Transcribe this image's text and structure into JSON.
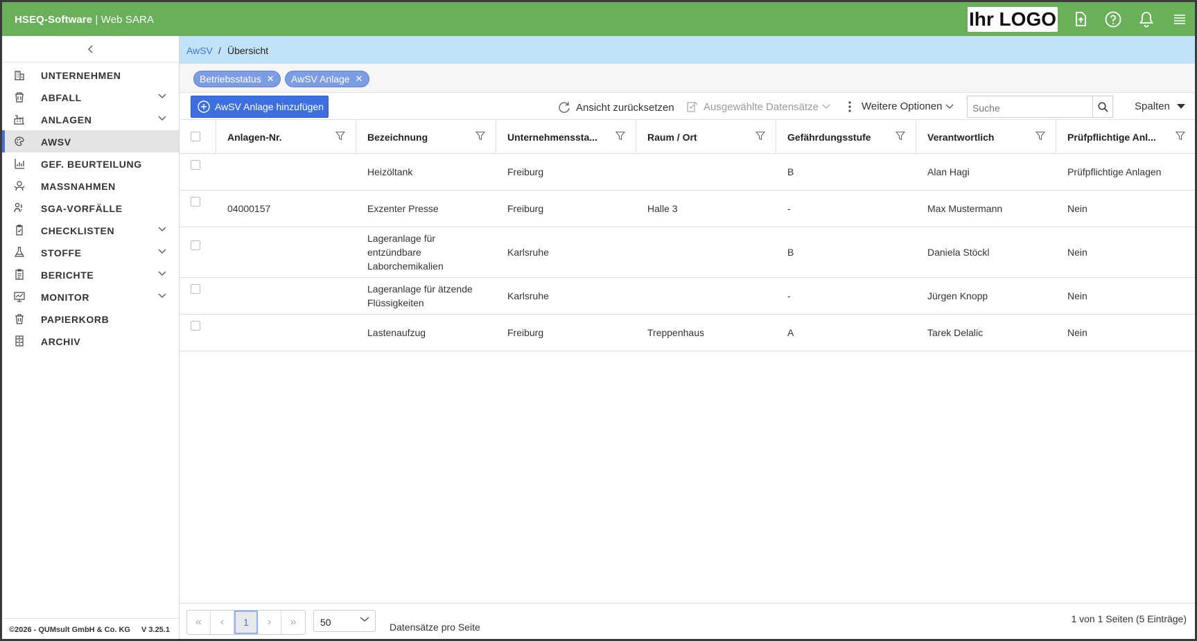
{
  "header": {
    "brand_bold": "HSEQ-Software",
    "brand_sep": " | ",
    "brand_rest": "Web SARA",
    "logo_text": "Ihr LOGO",
    "icons": [
      "file-upload-icon",
      "help-icon",
      "bell-icon",
      "menu-icon"
    ]
  },
  "sidebar": {
    "items": [
      {
        "label": "UNTERNEHMEN",
        "icon": "building-icon",
        "chevron": false,
        "active": false
      },
      {
        "label": "ABFALL",
        "icon": "waste-bin-icon",
        "chevron": true,
        "active": false
      },
      {
        "label": "ANLAGEN",
        "icon": "factory-icon",
        "chevron": true,
        "active": false
      },
      {
        "label": "AWSV",
        "icon": "water-drop-icon",
        "chevron": false,
        "active": true
      },
      {
        "label": "GEF. BEURTEILUNG",
        "icon": "risk-chart-icon",
        "chevron": false,
        "active": false
      },
      {
        "label": "MASSNAHMEN",
        "icon": "measures-icon",
        "chevron": false,
        "active": false
      },
      {
        "label": "SGA-VORFÄLLE",
        "icon": "incident-icon",
        "chevron": false,
        "active": false
      },
      {
        "label": "CHECKLISTEN",
        "icon": "clipboard-check-icon",
        "chevron": true,
        "active": false
      },
      {
        "label": "STOFFE",
        "icon": "flask-icon",
        "chevron": true,
        "active": false
      },
      {
        "label": "BERICHTE",
        "icon": "report-icon",
        "chevron": true,
        "active": false
      },
      {
        "label": "MONITOR",
        "icon": "monitor-icon",
        "chevron": true,
        "active": false
      },
      {
        "label": "PAPIERKORB",
        "icon": "trash-icon",
        "chevron": false,
        "active": false
      },
      {
        "label": "ARCHIV",
        "icon": "archive-icon",
        "chevron": false,
        "active": false
      }
    ],
    "footer_copyright": "©2026 - QUMsult GmbH & Co. KG",
    "footer_version": "V 3.25.1"
  },
  "breadcrumb": {
    "link": "AwSV",
    "separator": "/",
    "current": "Übersicht"
  },
  "filter_chips": [
    "Betriebsstatus",
    "AwSV Anlage"
  ],
  "toolbar": {
    "add_label": "AwSV Anlage hinzufügen",
    "reset_label": "Ansicht zurücksetzen",
    "selected_label": "Ausgewählte Datensätze",
    "more_label": "Weitere Optionen",
    "search_placeholder": "Suche",
    "columns_label": "Spalten"
  },
  "table": {
    "columns": [
      "Anlagen-Nr.",
      "Bezeichnung",
      "Unternehmenssta...",
      "Raum / Ort",
      "Gefährdungsstufe",
      "Verantwortlich",
      "Prüfpflichtige Anl..."
    ],
    "rows": [
      {
        "nr": "",
        "bez": [
          "Heizöltank"
        ],
        "standort": "Freiburg",
        "raum": "",
        "stufe": "B",
        "verantw": "Alan Hagi",
        "pruef": "Prüfpflichtige Anlagen"
      },
      {
        "nr": "04000157",
        "bez": [
          "Exzenter Presse"
        ],
        "standort": "Freiburg",
        "raum": "Halle 3",
        "stufe": "-",
        "verantw": "Max Mustermann",
        "pruef": "Nein"
      },
      {
        "nr": "",
        "bez": [
          "Lageranlage für",
          "entzündbare",
          "Laborchemikalien"
        ],
        "standort": "Karlsruhe",
        "raum": "",
        "stufe": "B",
        "verantw": "Daniela Stöckl",
        "pruef": "Nein"
      },
      {
        "nr": "",
        "bez": [
          "Lageranlage für ätzende",
          "Flüssigkeiten"
        ],
        "standort": "Karlsruhe",
        "raum": "",
        "stufe": "-",
        "verantw": "Jürgen Knopp",
        "pruef": "Nein"
      },
      {
        "nr": "",
        "bez": [
          "Lastenaufzug"
        ],
        "standort": "Freiburg",
        "raum": "Treppenhaus",
        "stufe": "A",
        "verantw": "Tarek Delalic",
        "pruef": "Nein"
      }
    ]
  },
  "pager": {
    "first": "«",
    "prev": "‹",
    "current_page": "1",
    "next": "›",
    "last": "»",
    "page_size": "50",
    "page_size_label": "Datensätze pro Seite",
    "info": "1 von 1 Seiten (5 Einträge)"
  }
}
